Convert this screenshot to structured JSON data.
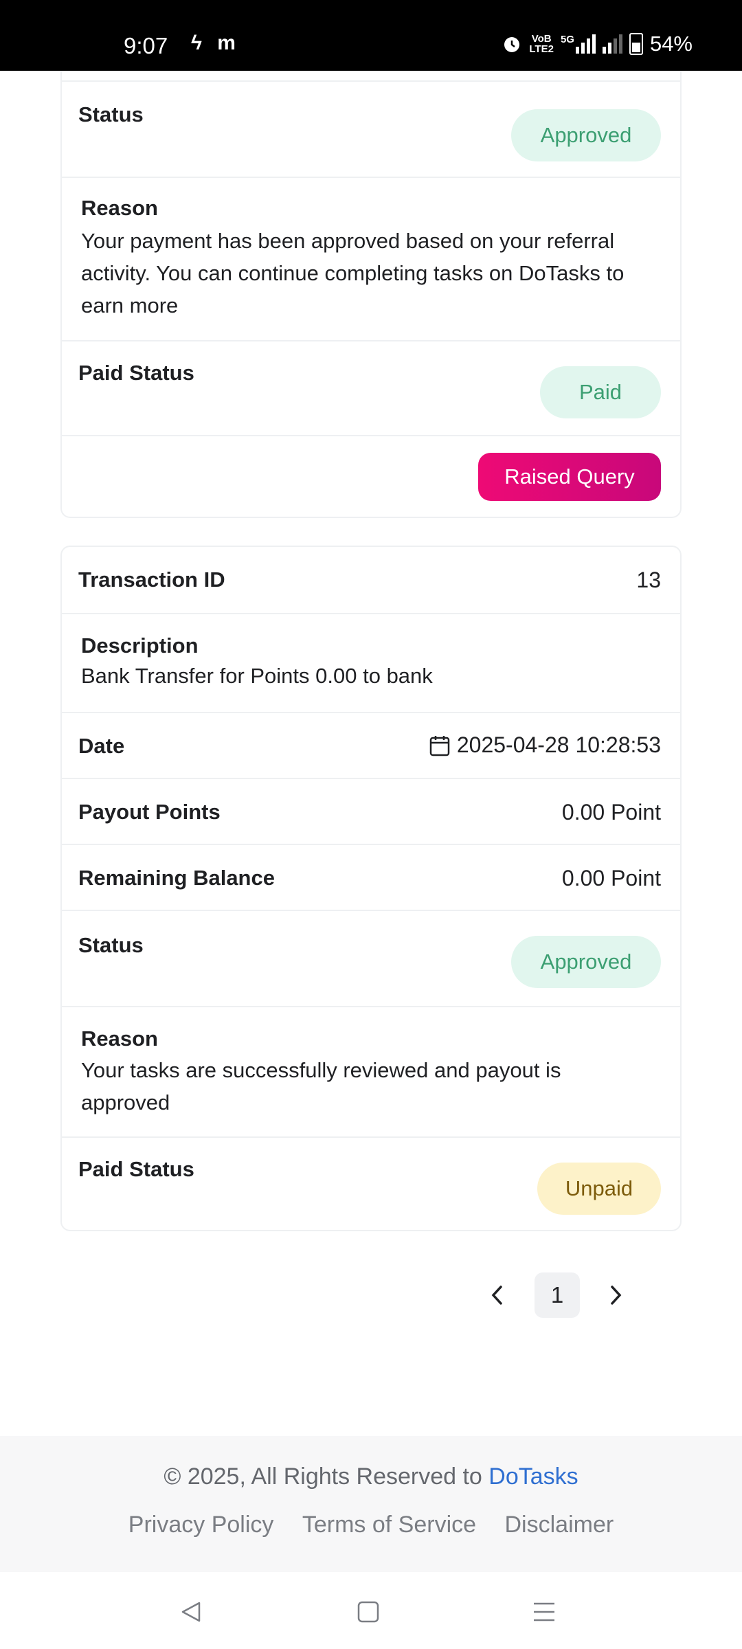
{
  "status_bar": {
    "time": "9:07",
    "left_icons": [
      "flash-icon",
      "m-app-icon"
    ],
    "volte_label_top": "VoB",
    "volte_label_bottom": "LTE2",
    "network_label": "5G",
    "battery": "54%"
  },
  "card1": {
    "status_label": "Status",
    "status_value": "Approved",
    "reason_label": "Reason",
    "reason_text": "Your payment has been approved based on your referral activity. You can continue completing tasks on DoTasks to earn more",
    "paid_status_label": "Paid Status",
    "paid_status_value": "Paid",
    "raised_query_label": "Raised Query"
  },
  "card2": {
    "transaction_id_label": "Transaction ID",
    "transaction_id_value": "13",
    "description_label": "Description",
    "description_text": "Bank Transfer for Points 0.00 to bank",
    "date_label": "Date",
    "date_value": "2025-04-28 10:28:53",
    "payout_points_label": "Payout Points",
    "payout_points_value": "0.00 Point",
    "remaining_balance_label": "Remaining Balance",
    "remaining_balance_value": "0.00 Point",
    "status_label": "Status",
    "status_value": "Approved",
    "reason_label": "Reason",
    "reason_text": "Your tasks are successfully reviewed and payout is approved",
    "paid_status_label": "Paid Status",
    "paid_status_value": "Unpaid"
  },
  "pagination": {
    "current_page": "1"
  },
  "footer": {
    "copyright_prefix": "© 2025, All Rights Reserved to ",
    "brand": "DoTasks",
    "links": [
      "Privacy Policy",
      "Terms of Service",
      "Disclaimer"
    ]
  },
  "colors": {
    "approved_bg": "#e1f6ee",
    "approved_text": "#3c9f72",
    "unpaid_bg": "#fdf2c9",
    "query_button": "#e5097a",
    "link": "#2f6fd1"
  }
}
